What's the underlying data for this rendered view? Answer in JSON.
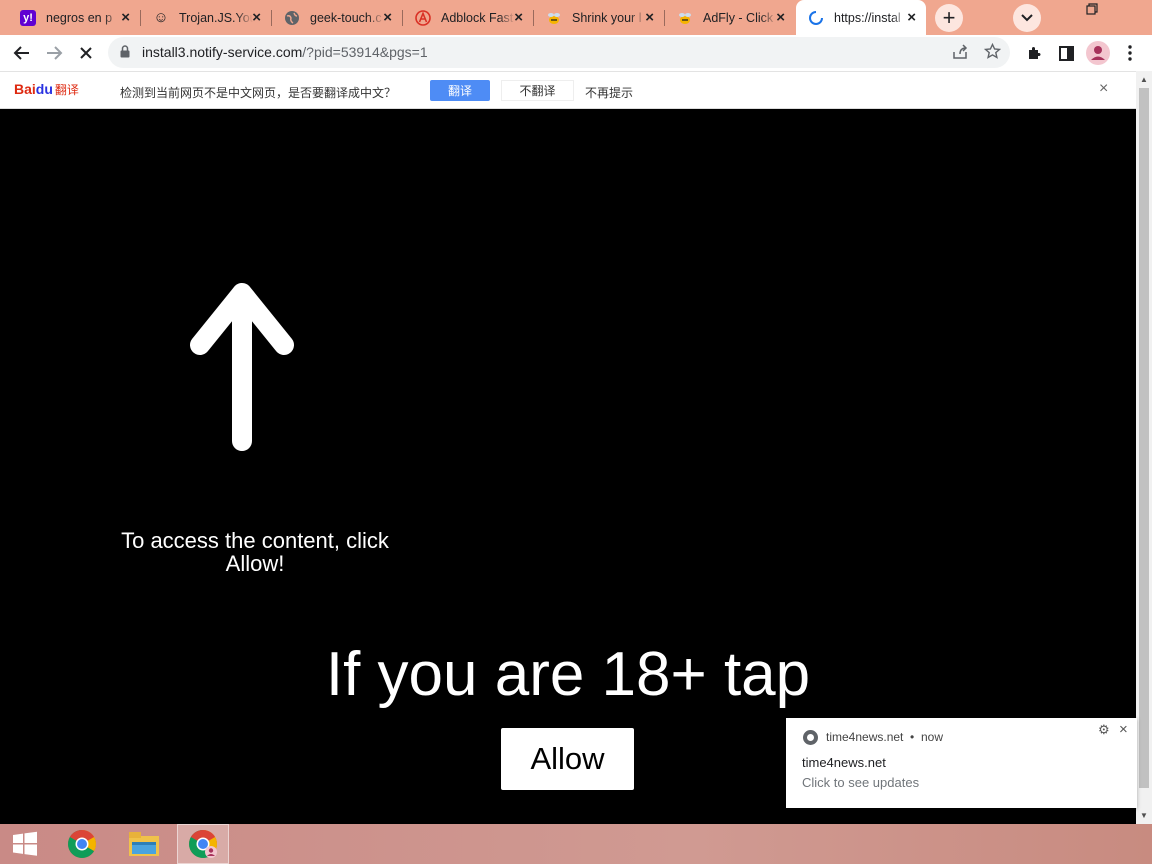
{
  "browser": {
    "tabs": [
      {
        "title": "negros en p",
        "favicon": "yahoo-icon",
        "favicon_color": "#6001d2",
        "favicon_text": "y!"
      },
      {
        "title": "Trojan.JS.You",
        "favicon": "smiley-icon",
        "favicon_color": "#ffffff",
        "favicon_text": "☺"
      },
      {
        "title": "geek-touch.c",
        "favicon": "globe-icon",
        "favicon_color": "#5f6368",
        "favicon_text": ""
      },
      {
        "title": "Adblock Fast",
        "favicon": "adblock-icon",
        "favicon_color": "#d93025",
        "favicon_text": "A"
      },
      {
        "title": "Shrink your l",
        "favicon": "adfly-bee-icon",
        "favicon_color": "#f5b400",
        "favicon_text": ""
      },
      {
        "title": "AdFly - Click",
        "favicon": "adfly-bee-icon",
        "favicon_color": "#f5b400",
        "favicon_text": ""
      },
      {
        "title": "https://instal",
        "favicon": "loading-spinner-icon",
        "favicon_color": "#1a73e8",
        "favicon_text": "",
        "active": true
      }
    ],
    "new_tab_symbol": "+",
    "url_host": "install3.notify-service.com",
    "url_rest": "/?pid=53914&pgs=1"
  },
  "baidu_bar": {
    "logo_bai": "Bai",
    "logo_du": "du",
    "logo_fanyi": "翻译",
    "message": "检测到当前网页不是中文网页，是否要翻译成中文？",
    "translate_label": "翻译",
    "dont_translate_label": "不翻译",
    "never_label": "不再提示",
    "close_symbol": "×"
  },
  "page": {
    "access_text": "To access the content, click Allow!",
    "headline": "If you are 18+ tap",
    "allow_label": "Allow"
  },
  "notification": {
    "site": "time4news.net",
    "separator": "•",
    "time": "now",
    "title": "time4news.net",
    "body": "Click to see updates"
  },
  "colors": {
    "tabstrip": "#f0a78f",
    "page_bg": "#000000",
    "translate_btn": "#4e8cf5"
  }
}
